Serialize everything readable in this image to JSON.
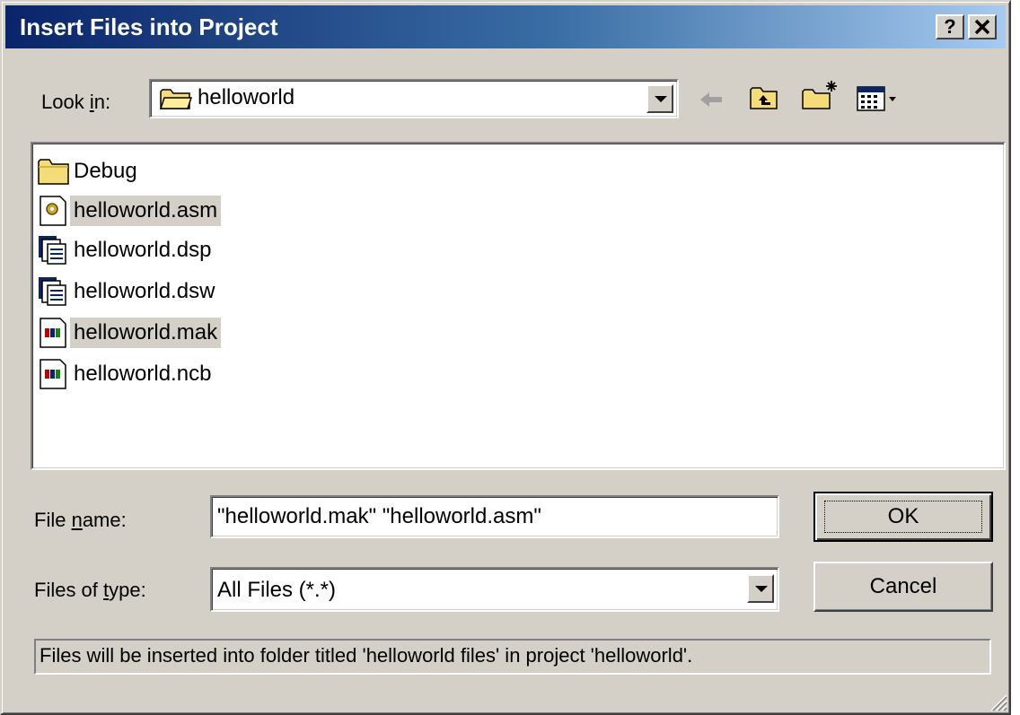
{
  "window": {
    "title": "Insert Files into Project",
    "help_button": "?",
    "close_button": "✕"
  },
  "lookin": {
    "label_pre": "Look ",
    "label_mnemonic": "i",
    "label_post": "n:",
    "value": "helloworld",
    "icons": [
      "back-arrow-icon",
      "up-one-level-icon",
      "new-folder-icon",
      "view-menu-icon"
    ]
  },
  "files": [
    {
      "name": "Debug",
      "icon": "folder-icon",
      "selected": false
    },
    {
      "name": "helloworld.asm",
      "icon": "asm-file-icon",
      "selected": true
    },
    {
      "name": "helloworld.dsp",
      "icon": "project-file-icon",
      "selected": false
    },
    {
      "name": "helloworld.dsw",
      "icon": "workspace-file-icon",
      "selected": false
    },
    {
      "name": "helloworld.mak",
      "icon": "makefile-icon",
      "selected": true
    },
    {
      "name": "helloworld.ncb",
      "icon": "ncb-file-icon",
      "selected": false
    }
  ],
  "filename": {
    "label_pre": "File ",
    "label_mnemonic": "n",
    "label_post": "ame:",
    "value": "\"helloworld.mak\" \"helloworld.asm\""
  },
  "filetype": {
    "label_pre": "Files of ",
    "label_mnemonic": "t",
    "label_post": "ype:",
    "value": "All Files (*.*)"
  },
  "buttons": {
    "ok": "OK",
    "cancel": "Cancel"
  },
  "status": "Files will be inserted into folder titled 'helloworld files' in project 'helloworld'.",
  "colors": {
    "title_gradient_start": "#0a246a",
    "title_gradient_end": "#a6caf0",
    "face": "#d4d0c8"
  }
}
